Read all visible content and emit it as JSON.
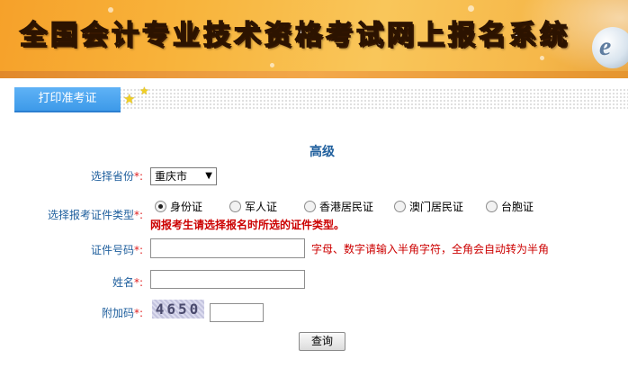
{
  "header": {
    "title": "全国会计专业技术资格考试网上报名系统",
    "logo_icon": "e-logo-icon"
  },
  "nav": {
    "tab_label": "打印准考证",
    "star_icon": "star-icon"
  },
  "form": {
    "section_title": "高级",
    "required_mark": "*:",
    "province": {
      "label": "选择省份",
      "selected": "重庆市"
    },
    "id_type": {
      "label": "选择报考证件类型",
      "options": [
        "身份证",
        "军人证",
        "香港居民证",
        "澳门居民证",
        "台胞证"
      ],
      "selected_index": 0,
      "warning": "网报考生请选择报名时所选的证件类型。"
    },
    "id_number": {
      "label": "证件号码",
      "value": "",
      "hint": "字母、数字请输入半角字符，全角会自动转为半角"
    },
    "name": {
      "label": "姓名",
      "value": ""
    },
    "captcha": {
      "label": "附加码",
      "image_text": "4650",
      "value": ""
    },
    "submit_label": "查询"
  },
  "colors": {
    "banner": "#f8b43c",
    "tab": "#4aa3ee",
    "label": "#1f5f9d",
    "warning": "#cc0000"
  }
}
